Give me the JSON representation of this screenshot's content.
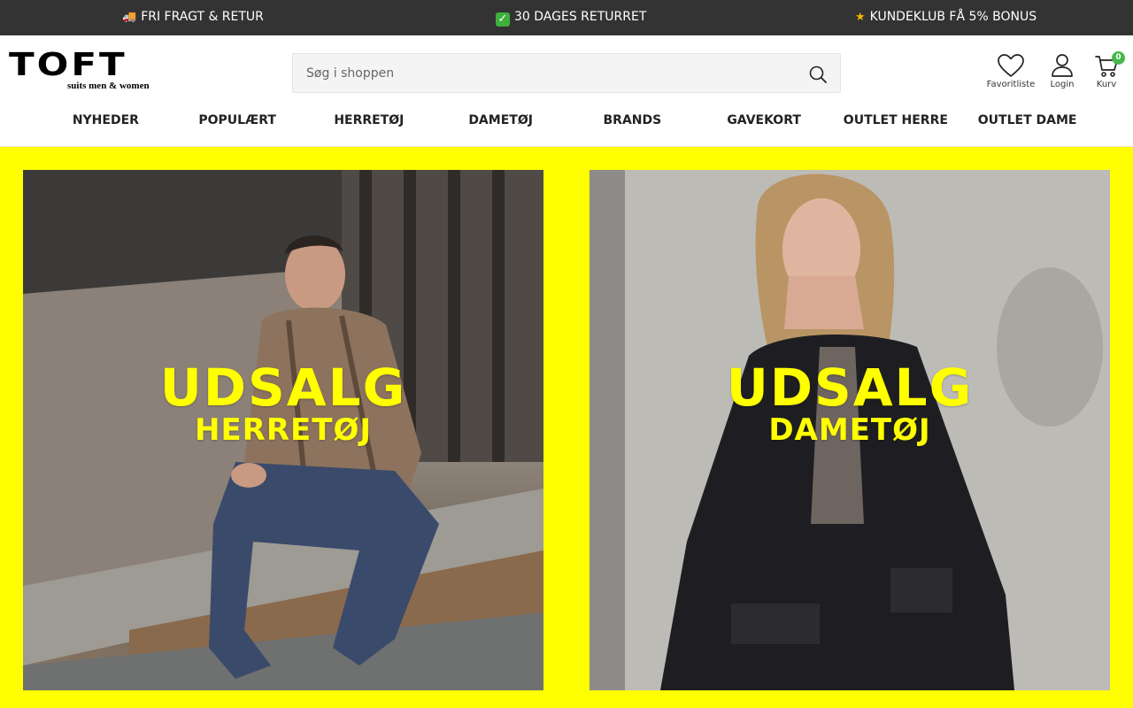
{
  "announcements": [
    {
      "icon": "truck-icon",
      "glyph": "🚚",
      "text": "FRI FRAGT & RETUR"
    },
    {
      "icon": "check-icon",
      "glyph": "✓",
      "text": "30 DAGES RETURRET"
    },
    {
      "icon": "star-icon",
      "glyph": "★",
      "text": "KUNDEKLUB FÅ 5% BONUS"
    }
  ],
  "header": {
    "logo": {
      "word": "TOFT",
      "tagline": "suits men & women"
    },
    "search": {
      "placeholder": "Søg i shoppen",
      "value": ""
    },
    "actions": {
      "favorites": "Favoritliste",
      "login": "Login",
      "cart": "Kurv",
      "cart_count": "0"
    }
  },
  "nav": [
    {
      "label": "NYHEDER"
    },
    {
      "label": "POPULÆRT"
    },
    {
      "label": "HERRETØJ"
    },
    {
      "label": "DAMETØJ"
    },
    {
      "label": "BRANDS"
    },
    {
      "label": "GAVEKORT"
    },
    {
      "label": "OUTLET HERRE"
    },
    {
      "label": "OUTLET DAME"
    }
  ],
  "hero": {
    "panels": [
      {
        "line1": "UDSALG",
        "line2": "HERRETØJ"
      },
      {
        "line1": "UDSALG",
        "line2": "DAMETØJ"
      }
    ]
  },
  "colors": {
    "topbar": "#333333",
    "hero_background": "#ffff00",
    "overlay_text": "#ffff00",
    "cart_badge": "#46b84a"
  }
}
